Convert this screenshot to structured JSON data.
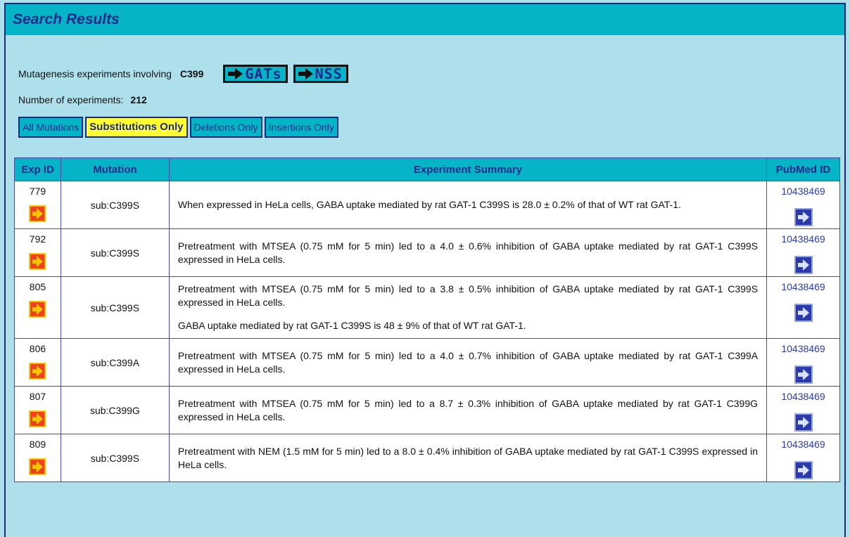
{
  "header": {
    "title": "Search Results"
  },
  "query": {
    "label": "Mutagenesis experiments involving",
    "residue": "C399",
    "buttons": [
      {
        "label": "GATs",
        "icon": "right-arrow-icon"
      },
      {
        "label": "NSS",
        "icon": "right-arrow-icon"
      }
    ]
  },
  "count": {
    "label": "Number of experiments:",
    "value": "212"
  },
  "filters": [
    {
      "label": "All Mutations",
      "active": false
    },
    {
      "label": "Substitutions Only",
      "active": true
    },
    {
      "label": "Deletions Only",
      "active": false
    },
    {
      "label": "Insertions Only",
      "active": false
    }
  ],
  "table": {
    "columns": [
      "Exp ID",
      "Mutation",
      "Experiment Summary",
      "PubMed ID"
    ],
    "rows": [
      {
        "exp_id": "779",
        "mutation": "sub:C399S",
        "summary": [
          "When expressed in HeLa cells, GABA uptake mediated by rat GAT-1 C399S is 28.0 ± 0.2% of that of WT rat GAT-1."
        ],
        "pubmed": "10438469"
      },
      {
        "exp_id": "792",
        "mutation": "sub:C399S",
        "summary": [
          "Pretreatment with MTSEA (0.75 mM for 5 min) led to a 4.0 ± 0.6% inhibition of GABA uptake mediated by rat GAT-1 C399S expressed in HeLa cells."
        ],
        "pubmed": "10438469"
      },
      {
        "exp_id": "805",
        "mutation": "sub:C399S",
        "summary": [
          "Pretreatment with MTSEA (0.75 mM for 5 min) led to a 3.8 ± 0.5% inhibition of GABA uptake mediated by rat GAT-1 C399S expressed in HeLa cells.",
          "GABA uptake mediated by rat GAT-1 C399S is 48 ± 9% of that of WT rat GAT-1."
        ],
        "pubmed": "10438469"
      },
      {
        "exp_id": "806",
        "mutation": "sub:C399A",
        "summary": [
          "Pretreatment with MTSEA (0.75 mM for 5 min) led to a 4.0 ± 0.7% inhibition of GABA uptake mediated by rat GAT-1 C399A expressed in HeLa cells."
        ],
        "pubmed": "10438469"
      },
      {
        "exp_id": "807",
        "mutation": "sub:C399G",
        "summary": [
          "Pretreatment with MTSEA (0.75 mM for 5 min) led to a 8.7 ± 0.3% inhibition of GABA uptake mediated by rat GAT-1 C399G expressed in HeLa cells."
        ],
        "pubmed": "10438469"
      },
      {
        "exp_id": "809",
        "mutation": "sub:C399S",
        "summary": [
          "Pretreatment with NEM (1.5 mM for 5 min) led to a 8.0 ± 0.4% inhibition of GABA uptake mediated by rat GAT-1 C399S expressed in HeLa cells."
        ],
        "pubmed": "10438469"
      }
    ]
  },
  "colors": {
    "title_bar": "#06b4c8",
    "background": "#aee0ec",
    "active_filter": "#ffff33",
    "exp_icon": "#f04020",
    "pubmed_icon": "#2b3aa8"
  }
}
